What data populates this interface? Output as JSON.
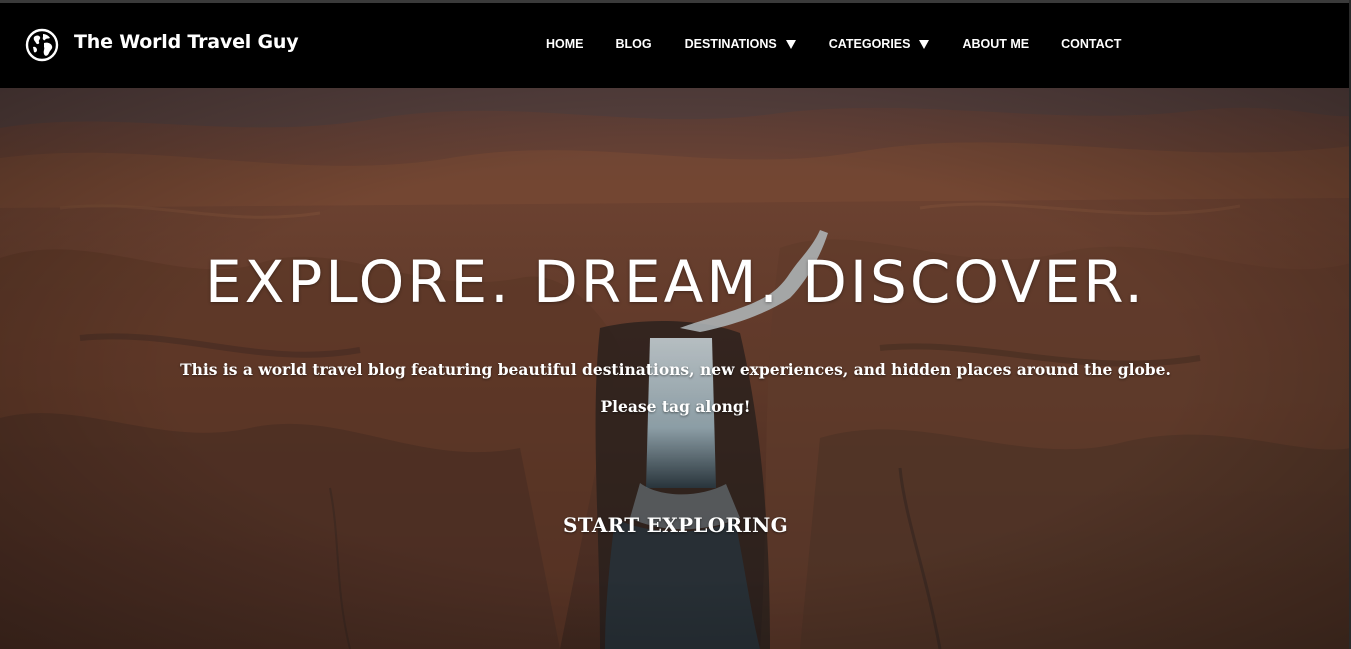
{
  "brand": {
    "name": "The World Travel Guy",
    "icon": "globe-icon"
  },
  "nav": {
    "items": [
      {
        "label": "HOME",
        "has_dropdown": false
      },
      {
        "label": "BLOG",
        "has_dropdown": false
      },
      {
        "label": "DESTINATIONS",
        "has_dropdown": true
      },
      {
        "label": "CATEGORIES",
        "has_dropdown": true
      },
      {
        "label": "ABOUT ME",
        "has_dropdown": false
      },
      {
        "label": "CONTACT",
        "has_dropdown": false
      }
    ]
  },
  "hero": {
    "title": "EXPLORE. DREAM. DISCOVER.",
    "subtitle": "This is a world travel blog featuring beautiful destinations, new experiences, and hidden places around the globe.",
    "subtitle2": "Please tag along!",
    "cta_label": "START EXPLORING",
    "background": "aerial-waterfall-canyon-image"
  },
  "colors": {
    "navbar_bg": "#000000",
    "text": "#ffffff",
    "terrain": "#7a4a36"
  }
}
